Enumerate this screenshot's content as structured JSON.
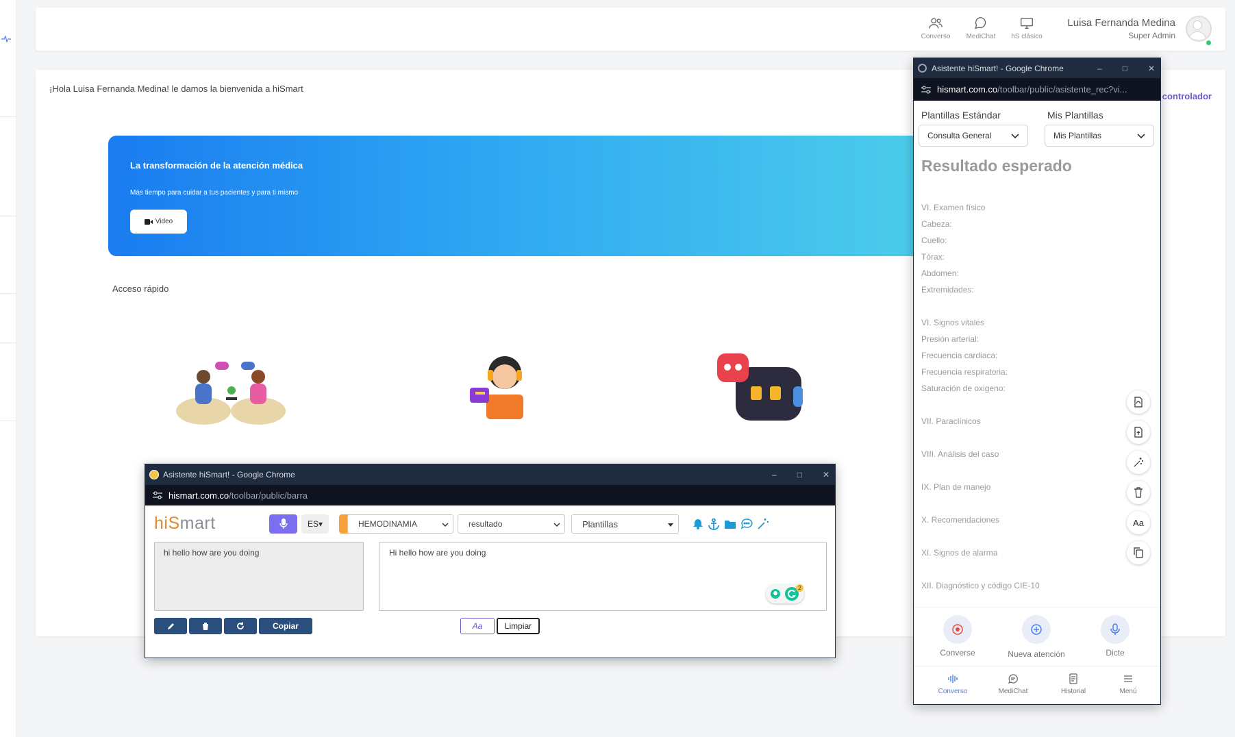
{
  "header": {
    "nav": [
      {
        "label": "Converso",
        "icon": "users-icon"
      },
      {
        "label": "MediChat",
        "icon": "chat-bubble-icon"
      },
      {
        "label": "hS clásico",
        "icon": "monitor-icon"
      }
    ],
    "user_name": "Luisa Fernanda Medina",
    "user_role": "Super Admin"
  },
  "main": {
    "welcome": "¡Hola Luisa Fernanda Medina! le damos la bienvenida a hiSmart",
    "controlador_link": "controlador",
    "banner": {
      "title": "La transformación de la atención médica",
      "subtitle": "Más tiempo para cuidar a tus pacientes y para ti mismo",
      "video_label": "Video"
    },
    "quick_access": "Acceso rápido"
  },
  "toolbar_window": {
    "title": "Asistente hiSmart! - Google Chrome",
    "url_domain": "hismart.com.co",
    "url_path": "/toolbar/public/barra",
    "logo_hi": "hiS",
    "logo_rest": "mart",
    "lang": "ES",
    "info": "i",
    "select_specialty": "HEMODINAMIA",
    "select_type": "resultado",
    "select_templates": "Plantillas",
    "input_text": "hi hello how are you doing",
    "output_text": "Hi hello how are you doing",
    "grammar_count": "2",
    "copy_label": "Copiar",
    "aa_label": "Aa",
    "clear_label": "Limpiar"
  },
  "assistant_window": {
    "title": "Asistente hiSmart! - Google Chrome",
    "url_domain": "hismart.com.co",
    "url_path": "/toolbar/public/asistente_rec?vi...",
    "std_templates_label": "Plantillas Estándar",
    "std_templates_value": "Consulta General",
    "my_templates_label": "Mis Plantillas",
    "my_templates_value": "Mis Plantillas",
    "result_title": "Resultado esperado",
    "lines": [
      "VI. Examen físico",
      "Cabeza:",
      "Cuello:",
      "Tórax:",
      "Abdomen:",
      "Extremidades:",
      "VI. Signos vitales",
      "Presión arterial:",
      "Frecuencia cardiaca:",
      "Frecuencia respiratoria:",
      "Saturación de oxigeno:",
      "VII. Paraclínicos",
      "VIII. Análisis del caso",
      "IX. Plan de manejo",
      "X. Recomendaciones",
      "XI. Signos de alarma",
      "XII. Diagnóstico  y código CIE-10"
    ],
    "aa_tool": "Aa",
    "actions": [
      {
        "label": "Converse"
      },
      {
        "label": "Nueva atención"
      },
      {
        "label": "Dicte"
      }
    ],
    "nav": [
      {
        "label": "Converso"
      },
      {
        "label": "MediChat"
      },
      {
        "label": "Historial"
      },
      {
        "label": "Menú"
      }
    ]
  },
  "colors": {
    "accent": "#4a7ef0",
    "purple": "#7b6ff0",
    "orange": "#f5a03a",
    "navy": "#2a4f7c",
    "titlebar": "#1f2b3e"
  }
}
